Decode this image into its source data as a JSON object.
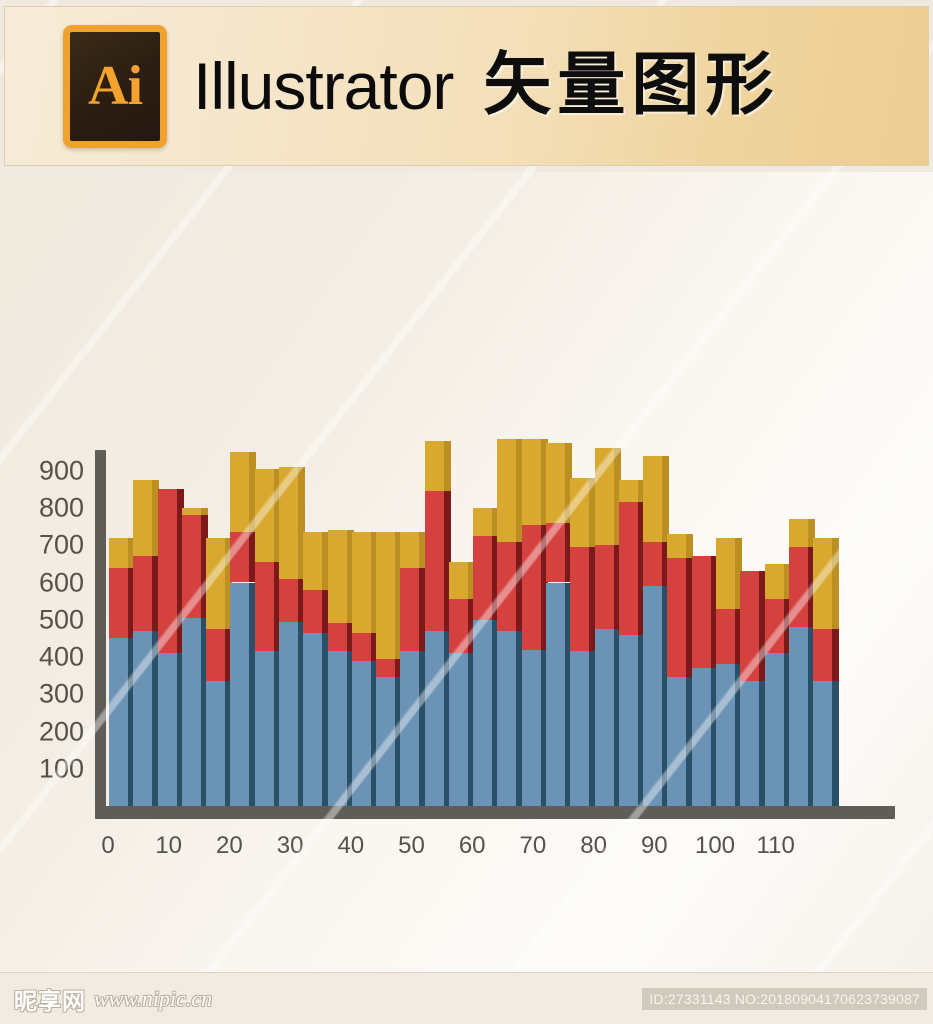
{
  "header": {
    "logo_glyph": "Ai",
    "logo_name": "illustrator-logo",
    "brand": "Illustrator",
    "cn_title": "矢量图形"
  },
  "footer": {
    "watermark_cn": "昵享网",
    "watermark_url": "www.nipic.cn",
    "id_text": "ID:27331143 NO:20180904170623739087"
  },
  "colors": {
    "blue": "#6b93b5",
    "blue_side": "#2a5068",
    "red": "#d4413f",
    "red_side": "#7c1a1b",
    "gold": "#d9a92f",
    "gold_side": "#bb8f22",
    "axis": "#5f5d58",
    "tick_text": "#55524c",
    "background": "#f6f2ea",
    "banner_start": "#f6ecd8",
    "banner_end": "#ecce93"
  },
  "chart_data": {
    "type": "bar",
    "subtype": "stacked-column-3d",
    "title": "",
    "xlabel": "",
    "ylabel": "",
    "xlim": [
      0,
      124
    ],
    "ylim": [
      0,
      1000
    ],
    "grid": false,
    "legend": "none",
    "ytick_labels": [
      "900",
      "800",
      "700",
      "600",
      "500",
      "400",
      "300",
      "200",
      "100"
    ],
    "ytick_values": [
      900,
      800,
      700,
      600,
      500,
      400,
      300,
      200,
      100
    ],
    "xtick_labels": [
      "0",
      "10",
      "20",
      "30",
      "40",
      "50",
      "60",
      "70",
      "80",
      "90",
      "100",
      "110"
    ],
    "xtick_values": [
      0,
      10,
      20,
      30,
      40,
      50,
      60,
      70,
      80,
      90,
      100,
      110
    ],
    "x": [
      0,
      4,
      8,
      12,
      16,
      20,
      24,
      28,
      32,
      36,
      40,
      44,
      48,
      52,
      56,
      60,
      64,
      68,
      72,
      76,
      80,
      84,
      88,
      92,
      96,
      100,
      104,
      108,
      112,
      116
    ],
    "series": [
      {
        "name": "blue",
        "color": "#6b93b5",
        "values": [
          450,
          470,
          410,
          505,
          335,
          600,
          415,
          495,
          465,
          415,
          390,
          345,
          415,
          470,
          410,
          500,
          470,
          420,
          600,
          415,
          475,
          460,
          590,
          345,
          370,
          380,
          335,
          410,
          480,
          335
        ]
      },
      {
        "name": "red",
        "color": "#d4413f",
        "values": [
          190,
          200,
          440,
          275,
          140,
          135,
          240,
          115,
          115,
          75,
          75,
          50,
          225,
          375,
          145,
          225,
          240,
          335,
          160,
          280,
          225,
          355,
          120,
          320,
          300,
          150,
          295,
          145,
          215,
          140
        ]
      },
      {
        "name": "gold",
        "color": "#d9a92f",
        "values": [
          80,
          205,
          0,
          20,
          245,
          215,
          250,
          300,
          155,
          250,
          270,
          340,
          95,
          135,
          100,
          75,
          275,
          230,
          215,
          185,
          260,
          60,
          230,
          65,
          0,
          190,
          0,
          95,
          75,
          245
        ]
      }
    ],
    "totals": [
      720,
      875,
      850,
      800,
      720,
      950,
      905,
      910,
      735,
      740,
      735,
      735,
      735,
      980,
      655,
      800,
      985,
      985,
      975,
      880,
      960,
      875,
      940,
      730,
      670,
      720,
      630,
      650,
      770,
      720
    ]
  }
}
